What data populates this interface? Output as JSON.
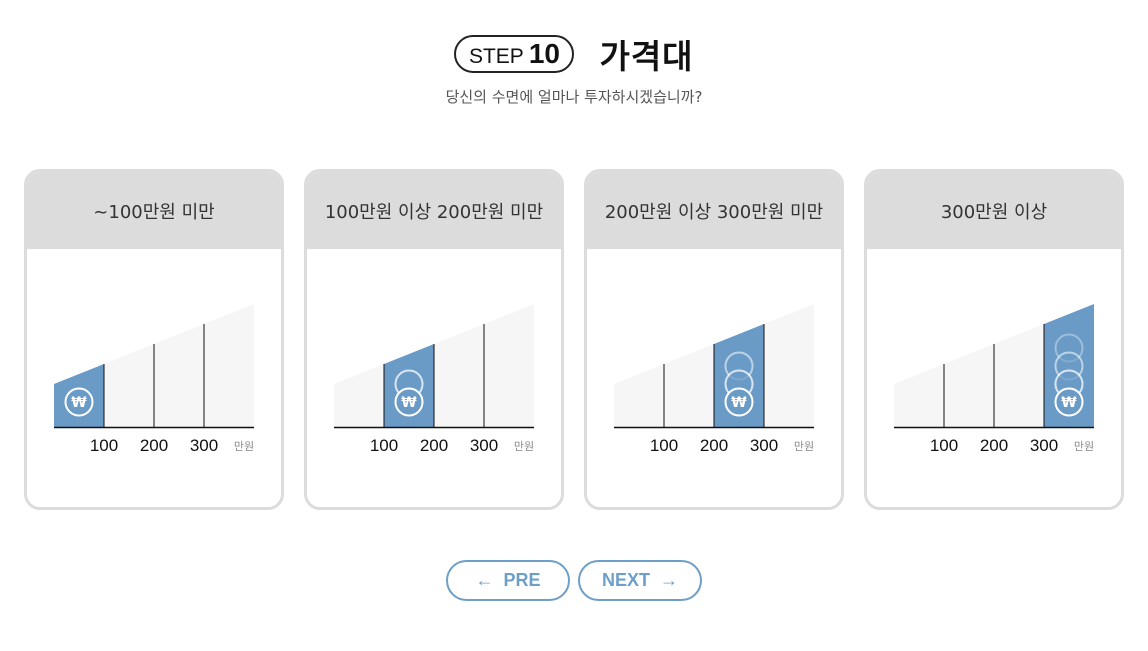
{
  "header": {
    "step_word": "STEP",
    "step_number": "10",
    "title": "가격대",
    "subtitle": "당신의 수면에 얼마나 투자하시겠습니까?"
  },
  "colors": {
    "highlight": "#6a9bc7",
    "light_area": "#f6f6f6",
    "card_border": "#dcdcdc",
    "accent": "#6e9fc8"
  },
  "chart": {
    "ticks": [
      "100",
      "200",
      "300"
    ],
    "unit": "만원",
    "coin_symbol": "₩"
  },
  "options": [
    {
      "label": "~100만원 미만",
      "highlight_segment": 0,
      "coins": 1
    },
    {
      "label": "100만원 이상 200만원 미만",
      "highlight_segment": 1,
      "coins": 2
    },
    {
      "label": "200만원 이상 300만원 미만",
      "highlight_segment": 2,
      "coins": 3
    },
    {
      "label": "300만원 이상",
      "highlight_segment": 3,
      "coins": 4
    }
  ],
  "nav": {
    "pre_arrow": "←",
    "pre_label": "PRE",
    "next_label": "NEXT",
    "next_arrow": "→"
  }
}
